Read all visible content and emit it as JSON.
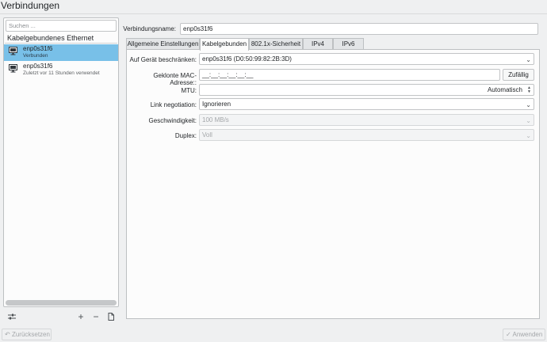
{
  "window": {
    "title": "Verbindungen"
  },
  "sidebar": {
    "search_placeholder": "Suchen ...",
    "section_heading": "Kabelgebundenes Ethernet",
    "connections": [
      {
        "name": "enp0s31f6",
        "status": "Verbunden",
        "selected": true,
        "icon": "monitor-network-icon"
      },
      {
        "name": "enp0s31f6",
        "status": "Zuletzt vor 11 Stunden verwendet",
        "selected": false,
        "icon": "monitor-network-icon"
      }
    ],
    "toolbar": {
      "configure_icon": "settings-sliders-icon",
      "add_symbol": "+",
      "remove_symbol": "−",
      "export_icon": "document-export-icon"
    }
  },
  "main": {
    "connection_name_label": "Verbindungsname:",
    "connection_name_value": "enp0s31f6",
    "tabs": [
      {
        "label": "Allgemeine Einstellungen",
        "active": false
      },
      {
        "label": "Kabelgebunden",
        "active": true
      },
      {
        "label": "802.1x-Sicherheit",
        "active": false
      },
      {
        "label": "IPv4",
        "active": false
      },
      {
        "label": "IPv6",
        "active": false
      }
    ],
    "wired": {
      "restrict_device_label": "Auf Gerät beschränken:",
      "restrict_device_value": "enp0s31f6 (D0:50:99:82:2B:3D)",
      "cloned_mac_label": "Geklonte MAC-Adresse::",
      "cloned_mac_value": "__:__:__:__:__:__",
      "random_button": "Zufällig",
      "mtu_label": "MTU:",
      "mtu_value": "Automatisch",
      "link_negotiation_label": "Link negotiation:",
      "link_negotiation_value": "Ignorieren",
      "speed_label": "Geschwindigkeit:",
      "speed_value": "100 MB/s",
      "duplex_label": "Duplex:",
      "duplex_value": "Voll"
    }
  },
  "footer": {
    "reset_label": "Zurücksetzen",
    "apply_label": "Anwenden"
  },
  "colors": {
    "window_bg": "#eff0f1",
    "selection": "#78c0e8",
    "panel_bg": "#fcfcfc",
    "border": "#bdc0c2"
  }
}
